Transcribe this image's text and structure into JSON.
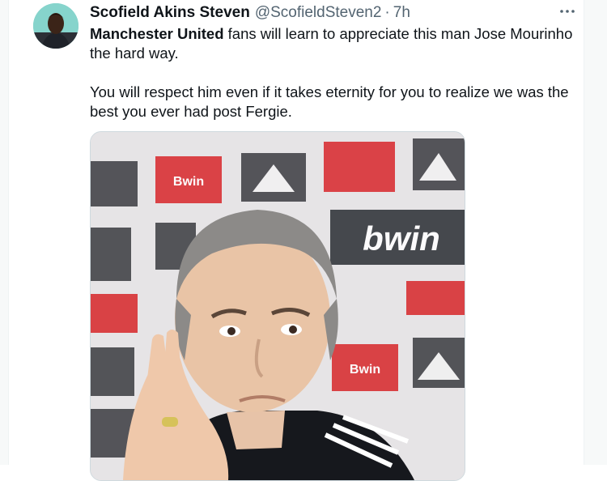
{
  "tweet": {
    "display_name": "Scofield Akins Steven",
    "handle": "@ScofieldSteven2",
    "separator": "·",
    "time": "7h",
    "paragraph1_bold": "Manchester United",
    "paragraph1_rest": " fans will learn to appreciate this man Jose Mourinho the hard way.",
    "paragraph2": "You will respect him even if it takes eternity for you to realize we was the best you ever had post Fergie."
  },
  "photo": {
    "backdrop_logos": [
      "Bwin",
      "bwin",
      "Bwin"
    ]
  },
  "icons": {
    "more": "more-horizontal-icon",
    "avatar": "profile-photo"
  },
  "colors": {
    "text": "#0f1419",
    "secondary": "#536471",
    "border": "#cfd9de",
    "sponsor_red": "#d7262a"
  }
}
